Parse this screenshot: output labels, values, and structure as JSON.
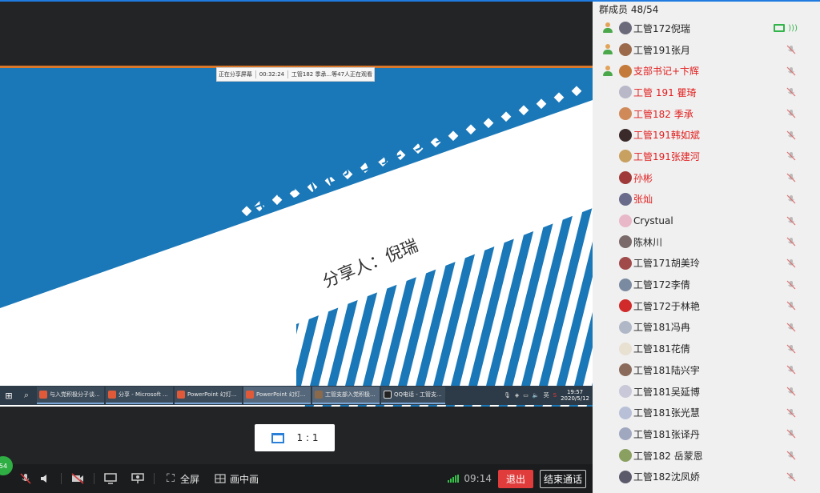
{
  "share_banner": {
    "status": "正在分享屏幕",
    "elapsed": "00:32:24",
    "viewers": "工管182 季承...等47人正在观看"
  },
  "slide": {
    "title": "学生干部经验分享",
    "subtitle": "分享人：倪瑞",
    "accent_color": "#1a78b8"
  },
  "taskbar": {
    "items": [
      {
        "label": "与入党积极分子谈...",
        "icon_color": "#e05a3a"
      },
      {
        "label": "分享 - Microsoft ...",
        "icon_color": "#e05a3a"
      },
      {
        "label": "PowerPoint 幻灯...",
        "icon_color": "#e05a3a"
      },
      {
        "label": "PowerPoint 幻灯...",
        "icon_color": "#e05a3a"
      },
      {
        "label": "工管支部入党积极...",
        "icon_color": "#8a6a4a"
      },
      {
        "label": "QQ电话 - 工管支...",
        "icon_color": "#222222"
      }
    ],
    "clock_time": "19:57",
    "clock_date": "2020/5/12",
    "lang": "英"
  },
  "ratio_button": {
    "label": "1 : 1"
  },
  "bottom_bar": {
    "fullscreen_label": "全屏",
    "pip_label": "画中画",
    "time": "09:14",
    "exit_label": "退出",
    "end_label": "结束通话",
    "avatar_badge": "54"
  },
  "members_panel": {
    "title": "群成员 48/54",
    "members": [
      {
        "name": "工管172倪瑞",
        "highlight": false,
        "avatar_color": "#6a6a7a",
        "speaking": true
      },
      {
        "name": "工管191张月",
        "highlight": false,
        "avatar_color": "#9a6a4a",
        "speaking": false
      },
      {
        "name": "支部书记+卞辉",
        "highlight": true,
        "avatar_color": "#c47a3a",
        "speaking": false
      },
      {
        "name": "工管 191 瞿琦",
        "highlight": true,
        "avatar_color": "#b8b8c8",
        "speaking": false
      },
      {
        "name": "工管182 季承",
        "highlight": true,
        "avatar_color": "#d08a5a",
        "speaking": false
      },
      {
        "name": "工管191韩如斌",
        "highlight": true,
        "avatar_color": "#3a2a2a",
        "speaking": false
      },
      {
        "name": "工管191张建河",
        "highlight": true,
        "avatar_color": "#c8a060",
        "speaking": false
      },
      {
        "name": "孙彬",
        "highlight": true,
        "avatar_color": "#a03a3a",
        "speaking": false
      },
      {
        "name": "张灿",
        "highlight": true,
        "avatar_color": "#6a6a8a",
        "speaking": false
      },
      {
        "name": "Crystual",
        "highlight": false,
        "avatar_color": "#e8b8c8",
        "speaking": false
      },
      {
        "name": "陈林川",
        "highlight": false,
        "avatar_color": "#7a6a6a",
        "speaking": false
      },
      {
        "name": "工管171胡美玲",
        "highlight": false,
        "avatar_color": "#a04a4a",
        "speaking": false
      },
      {
        "name": "工管172李倩",
        "highlight": false,
        "avatar_color": "#7a8aa0",
        "speaking": false
      },
      {
        "name": "工管172于林艳",
        "highlight": false,
        "avatar_color": "#d02a2a",
        "speaking": false
      },
      {
        "name": "工管181冯冉",
        "highlight": false,
        "avatar_color": "#b0b8c8",
        "speaking": false
      },
      {
        "name": "工管181花倩",
        "highlight": false,
        "avatar_color": "#e8e0d0",
        "speaking": false
      },
      {
        "name": "工管181陆兴宇",
        "highlight": false,
        "avatar_color": "#8a6a5a",
        "speaking": false
      },
      {
        "name": "工管181吴延博",
        "highlight": false,
        "avatar_color": "#c8c8d8",
        "speaking": false
      },
      {
        "name": "工管181张光慧",
        "highlight": false,
        "avatar_color": "#b8c0d8",
        "speaking": false
      },
      {
        "name": "工管181张译丹",
        "highlight": false,
        "avatar_color": "#a0a8c0",
        "speaking": false
      },
      {
        "name": "工管182 岳蒙恩",
        "highlight": false,
        "avatar_color": "#8aa060",
        "speaking": false
      },
      {
        "name": "工管182沈凤娇",
        "highlight": false,
        "avatar_color": "#5a5a6a",
        "speaking": false
      }
    ]
  }
}
